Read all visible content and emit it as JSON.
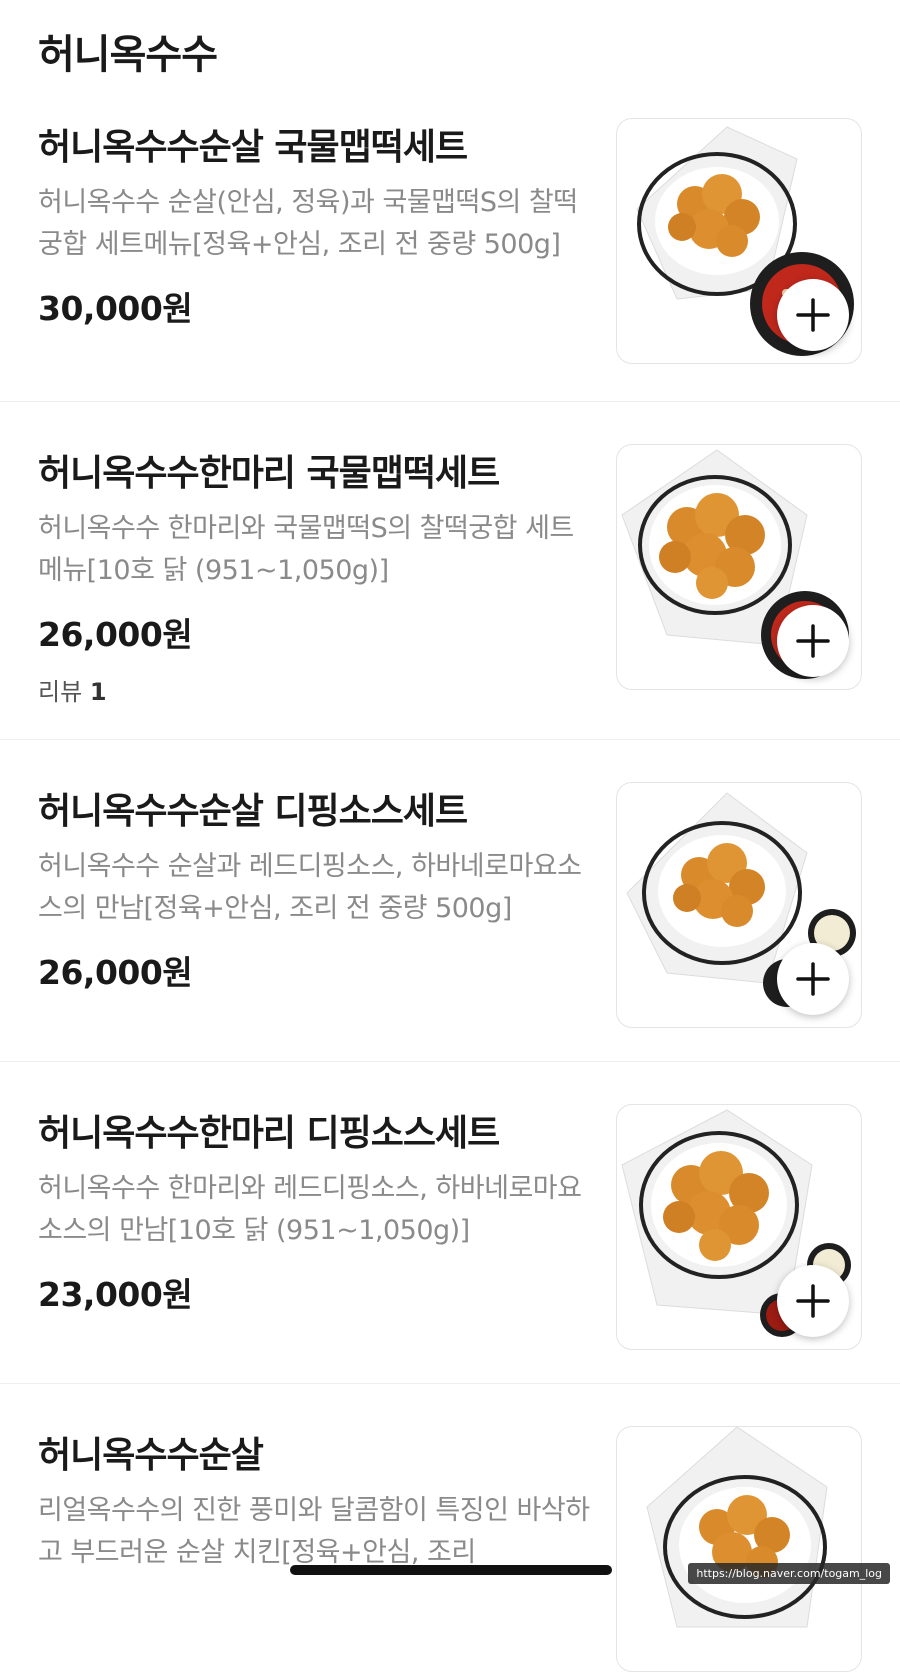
{
  "section": {
    "title": "허니옥수수"
  },
  "items": [
    {
      "name": "허니옥수수순살 국물맵떡세트",
      "description": "허니옥수수 순살(안심, 정육)과 국물맵떡S의 찰떡궁합 세트메뉴[정육+안심, 조리 전 중량 500g]",
      "price": "30,000원",
      "image_icon": "fried-chicken-with-tteokbokki-icon"
    },
    {
      "name": "허니옥수수한마리 국물맵떡세트",
      "description": "허니옥수수 한마리와 국물맵떡S의 찰떡궁합 세트메뉴[10호 닭 (951~1,050g)]",
      "price": "26,000원",
      "review_label": "리뷰",
      "review_count": "1",
      "image_icon": "fried-chicken-with-tteokbokki-icon"
    },
    {
      "name": "허니옥수수순살 디핑소스세트",
      "description": "허니옥수수 순살과 레드디핑소스, 하바네로마요소스의 만남[정육+안심, 조리 전 중량 500g]",
      "price": "26,000원",
      "image_icon": "fried-chicken-with-dipping-sauce-icon"
    },
    {
      "name": "허니옥수수한마리 디핑소스세트",
      "description": "허니옥수수 한마리와 레드디핑소스, 하바네로마요소스의 만남[10호 닭 (951~1,050g)]",
      "price": "23,000원",
      "image_icon": "fried-chicken-with-dipping-sauce-icon"
    },
    {
      "name": "허니옥수수순살",
      "description": "리얼옥수수의 진한 풍미와 달콤함이 특징인 바삭하고 부드러운 순살 치킨[정육+안심, 조리",
      "image_icon": "fried-chicken-icon"
    }
  ],
  "add_button_icon": "plus-icon",
  "watermark": "https://blog.naver.com/togam_log",
  "colors": {
    "text_primary": "#1a1a1a",
    "text_secondary": "#8a8a8a",
    "divider": "#eeeeee",
    "chicken": "#d98a2b",
    "tteokbokki": "#c0281c"
  }
}
